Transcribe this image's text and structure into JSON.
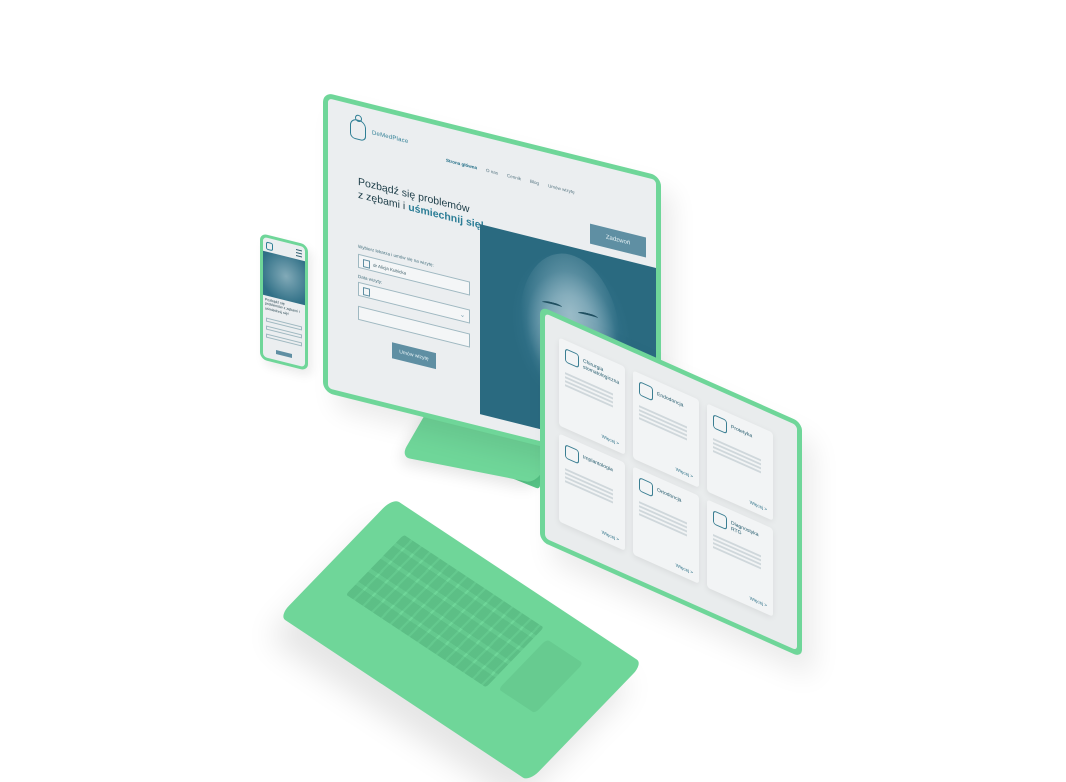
{
  "desktop": {
    "logo_text": "DeMedPlace",
    "nav": [
      "Strona główna",
      "O nas",
      "Cennik",
      "Blog",
      "Umów wizytę"
    ],
    "book_button": "Zadzwoń",
    "hero_title_line1": "Pozbądź się problemów",
    "hero_title_line2": "z zębami i",
    "hero_title_highlight": "uśmiechnij się!",
    "form_label_doctor": "Wybierz lekarza i umów się na wizytę:",
    "doctor_value": "dr Alicja Kubicka",
    "form_label_date": "Data wizyty:",
    "submit_button": "Umów wizytę"
  },
  "phone": {
    "hero_title": "Pozbądź się problemów z zębami i uśmiechnij się!"
  },
  "laptop": {
    "services": [
      {
        "title": "Chirurgia stomatologiczna",
        "more": "Więcej >",
        "icon": "dental-chair-icon"
      },
      {
        "title": "Endodoncja",
        "more": "Więcej >",
        "icon": "tooth-root-icon"
      },
      {
        "title": "Protetyka",
        "more": "Więcej >",
        "icon": "denture-icon"
      },
      {
        "title": "Implantologia",
        "more": "Więcej >",
        "icon": "implant-icon"
      },
      {
        "title": "Ortodoncja",
        "more": "Więcej >",
        "icon": "braces-icon"
      },
      {
        "title": "Diagnostyka RTG",
        "more": "Więcej >",
        "icon": "xray-icon"
      }
    ]
  },
  "colors": {
    "device_green": "#6fd699",
    "accent_teal": "#2b7d96",
    "screen_bg": "#ebeef0"
  }
}
